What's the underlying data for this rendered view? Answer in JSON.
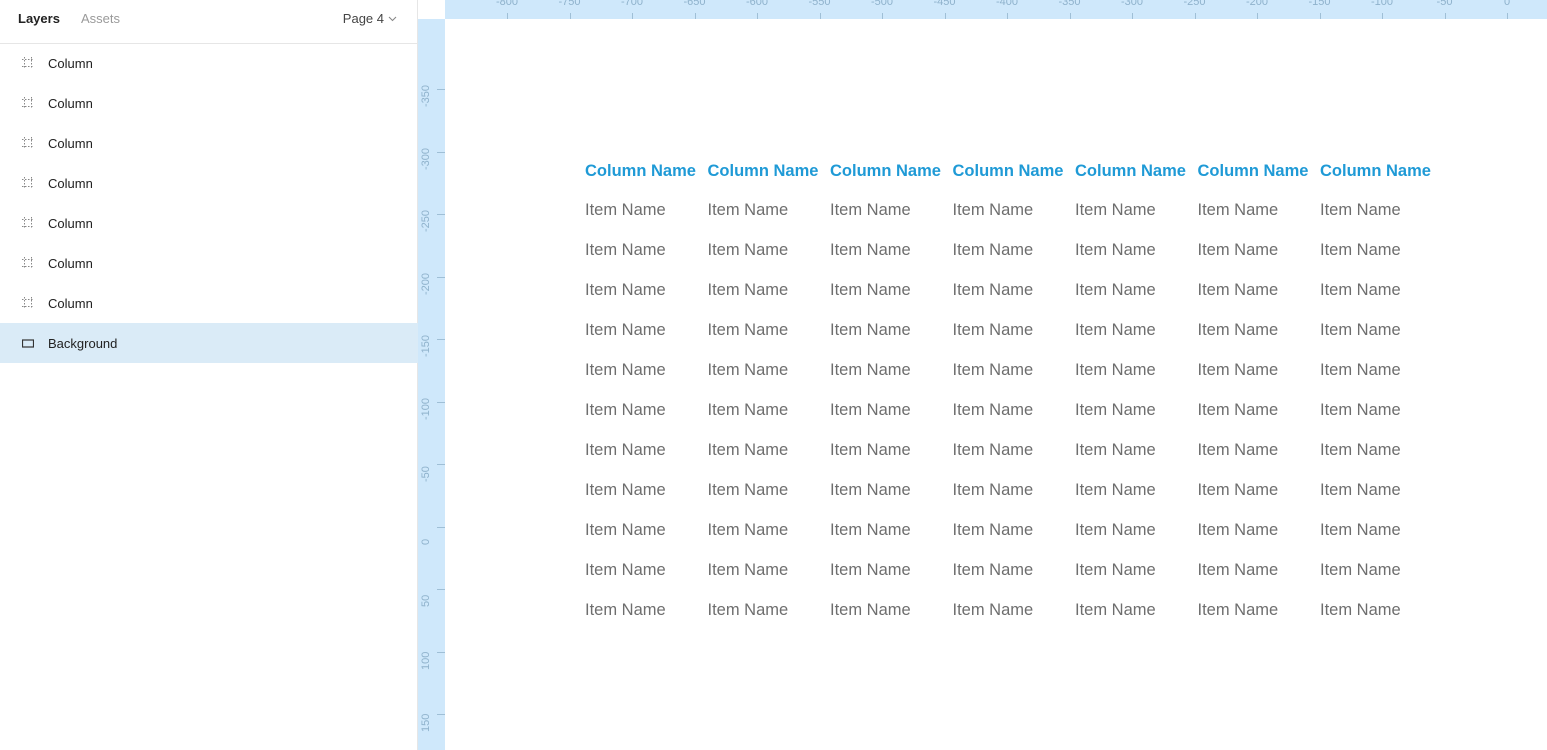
{
  "panel": {
    "tabs": {
      "layers": "Layers",
      "assets": "Assets"
    },
    "page_selector": "Page 4",
    "layers": [
      {
        "label": "Column",
        "icon": "frame-grid-icon",
        "selected": false
      },
      {
        "label": "Column",
        "icon": "frame-grid-icon",
        "selected": false
      },
      {
        "label": "Column",
        "icon": "frame-grid-icon",
        "selected": false
      },
      {
        "label": "Column",
        "icon": "frame-grid-icon",
        "selected": false
      },
      {
        "label": "Column",
        "icon": "frame-grid-icon",
        "selected": false
      },
      {
        "label": "Column",
        "icon": "frame-grid-icon",
        "selected": false
      },
      {
        "label": "Column",
        "icon": "frame-grid-icon",
        "selected": false
      },
      {
        "label": "Background",
        "icon": "rectangle-icon",
        "selected": true
      }
    ]
  },
  "rulers": {
    "top": [
      "-800",
      "-750",
      "-700",
      "-650",
      "-600",
      "-550",
      "-500",
      "-450",
      "-400",
      "-350",
      "-300",
      "-250",
      "-200",
      "-150",
      "-100",
      "-50",
      "0"
    ],
    "left": [
      "-350",
      "-300",
      "-250",
      "-200",
      "-150",
      "-100",
      "-50",
      "0",
      "50",
      "100",
      "150"
    ]
  },
  "table": {
    "columns": [
      {
        "header": "Column Name",
        "items": [
          "Item Name",
          "Item Name",
          "Item Name",
          "Item Name",
          "Item Name",
          "Item Name",
          "Item Name",
          "Item Name",
          "Item Name",
          "Item Name",
          "Item Name"
        ]
      },
      {
        "header": "Column Name",
        "items": [
          "Item Name",
          "Item Name",
          "Item Name",
          "Item Name",
          "Item Name",
          "Item Name",
          "Item Name",
          "Item Name",
          "Item Name",
          "Item Name",
          "Item Name"
        ]
      },
      {
        "header": "Column Name",
        "items": [
          "Item Name",
          "Item Name",
          "Item Name",
          "Item Name",
          "Item Name",
          "Item Name",
          "Item Name",
          "Item Name",
          "Item Name",
          "Item Name",
          "Item Name"
        ]
      },
      {
        "header": "Column Name",
        "items": [
          "Item Name",
          "Item Name",
          "Item Name",
          "Item Name",
          "Item Name",
          "Item Name",
          "Item Name",
          "Item Name",
          "Item Name",
          "Item Name",
          "Item Name"
        ]
      },
      {
        "header": "Column Name",
        "items": [
          "Item Name",
          "Item Name",
          "Item Name",
          "Item Name",
          "Item Name",
          "Item Name",
          "Item Name",
          "Item Name",
          "Item Name",
          "Item Name",
          "Item Name"
        ]
      },
      {
        "header": "Column Name",
        "items": [
          "Item Name",
          "Item Name",
          "Item Name",
          "Item Name",
          "Item Name",
          "Item Name",
          "Item Name",
          "Item Name",
          "Item Name",
          "Item Name",
          "Item Name"
        ]
      },
      {
        "header": "Column Name",
        "items": [
          "Item Name",
          "Item Name",
          "Item Name",
          "Item Name",
          "Item Name",
          "Item Name",
          "Item Name",
          "Item Name",
          "Item Name",
          "Item Name",
          "Item Name"
        ]
      }
    ]
  },
  "colors": {
    "accent": "#1f9ad6",
    "ruler_bg": "#cfe8fb",
    "selected_layer_bg": "#daebf7",
    "item_text": "#6e6e6e"
  }
}
